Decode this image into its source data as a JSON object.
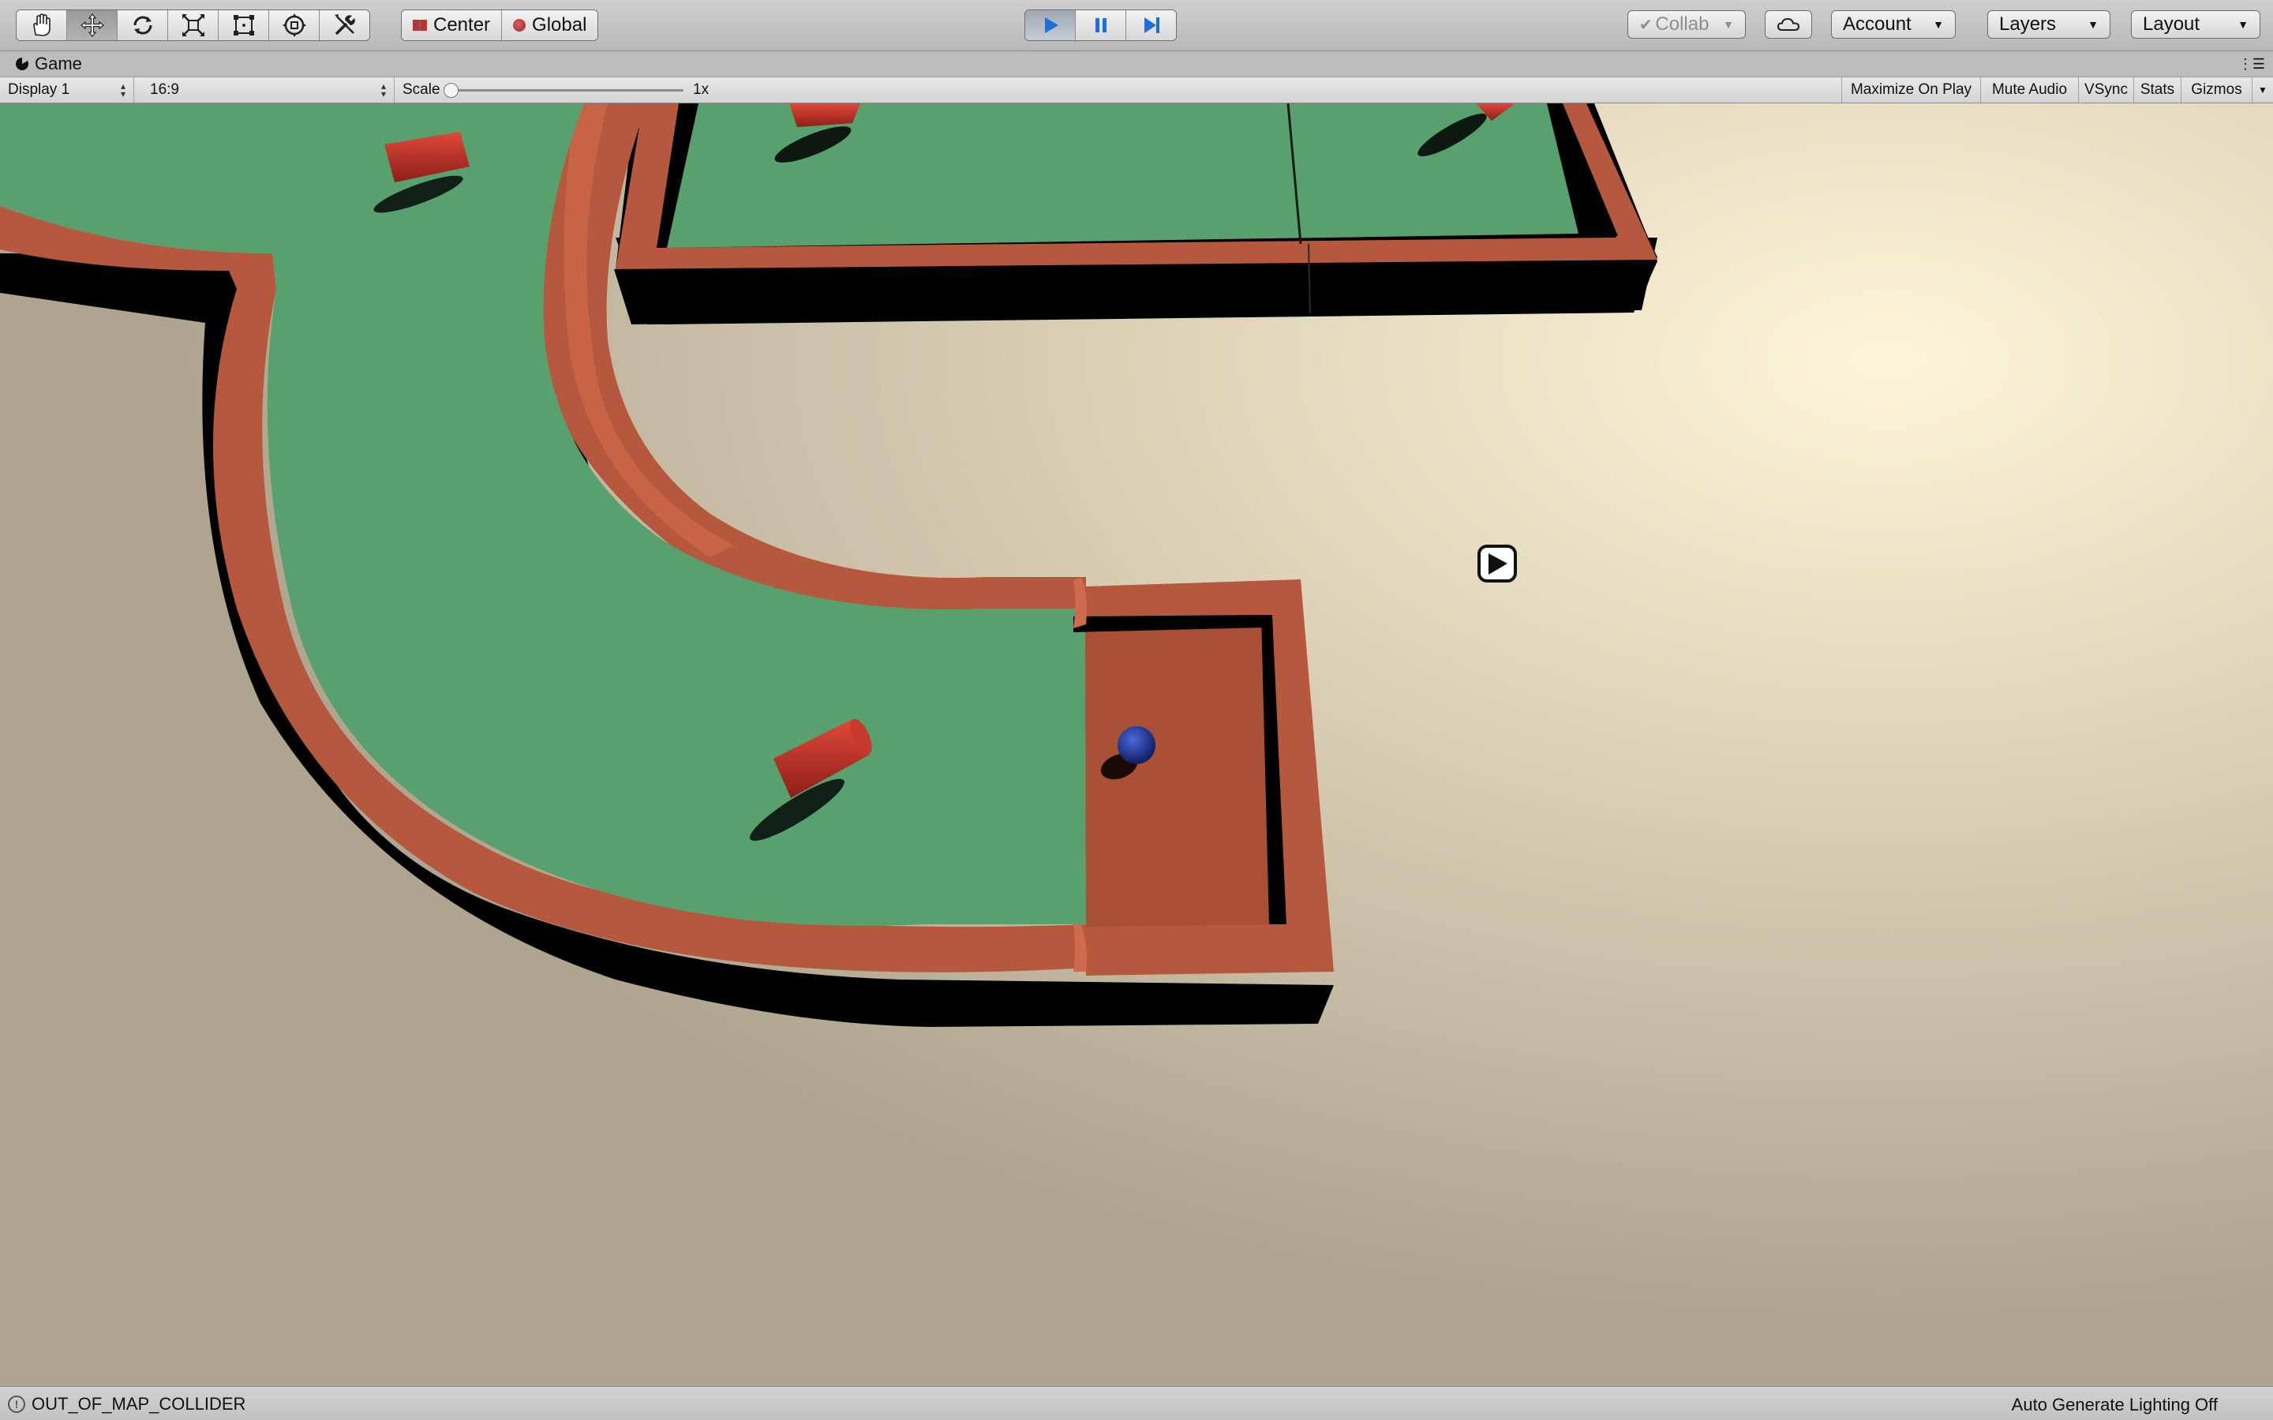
{
  "toolbar": {
    "tools": [
      "hand-tool",
      "move-tool",
      "rotate-tool",
      "scale-tool",
      "rect-tool",
      "transform-tool",
      "custom-tool"
    ],
    "pivot_mode": "Center",
    "pivot_rotation": "Global",
    "play_controls": [
      "play",
      "pause",
      "step"
    ],
    "collab": "Collab",
    "account": "Account",
    "layers": "Layers",
    "layout": "Layout"
  },
  "game_tab": {
    "title": "Game"
  },
  "game_controls": {
    "display": "Display 1",
    "aspect": "16:9",
    "scale_label": "Scale",
    "scale_value": "1x",
    "maximize_on_play": "Maximize On Play",
    "mute_audio": "Mute Audio",
    "vsync": "VSync",
    "stats": "Stats",
    "gizmos": "Gizmos"
  },
  "status": {
    "message": "OUT_OF_MAP_COLLIDER",
    "lighting": "Auto Generate Lighting Off"
  },
  "colors": {
    "grass": "#58a06d",
    "wall": "#b5583d",
    "wall_dark": "#9a4a32",
    "ball": "#1a2f8c",
    "sky_light": "#fbf3dc",
    "sky_dark": "#b5ac97"
  }
}
